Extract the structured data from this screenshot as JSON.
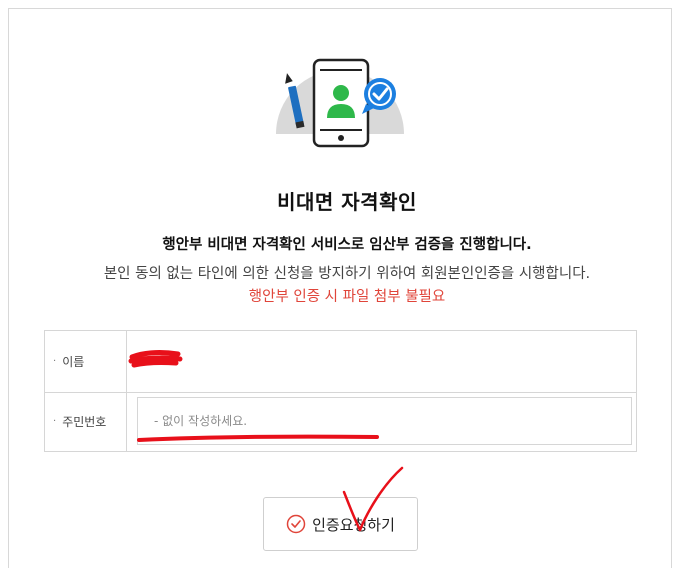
{
  "page": {
    "title": "비대면 자격확인",
    "subtitle": "행안부 비대면 자격확인 서비스로 임산부 검증을 진행합니다.",
    "description": "본인 동의 없는 타인에 의한 신청을 방지하기 위하여 회원본인인증을 시행합니다.",
    "notice": "행안부 인증 시 파일 첨부 불필요"
  },
  "form": {
    "name_label": "이름",
    "rrn_label": "주민번호",
    "rrn_placeholder": "- 없이 작성하세요."
  },
  "actions": {
    "verify_label": "인증요청하기"
  },
  "colors": {
    "accent_red": "#e0453a",
    "annotation_red": "#e8101a",
    "icon_blue": "#1c7fe0",
    "icon_green": "#2eb84a"
  },
  "icons": {
    "illustration": "phone-person-verified-illustration",
    "button_icon": "check-circle-icon"
  }
}
